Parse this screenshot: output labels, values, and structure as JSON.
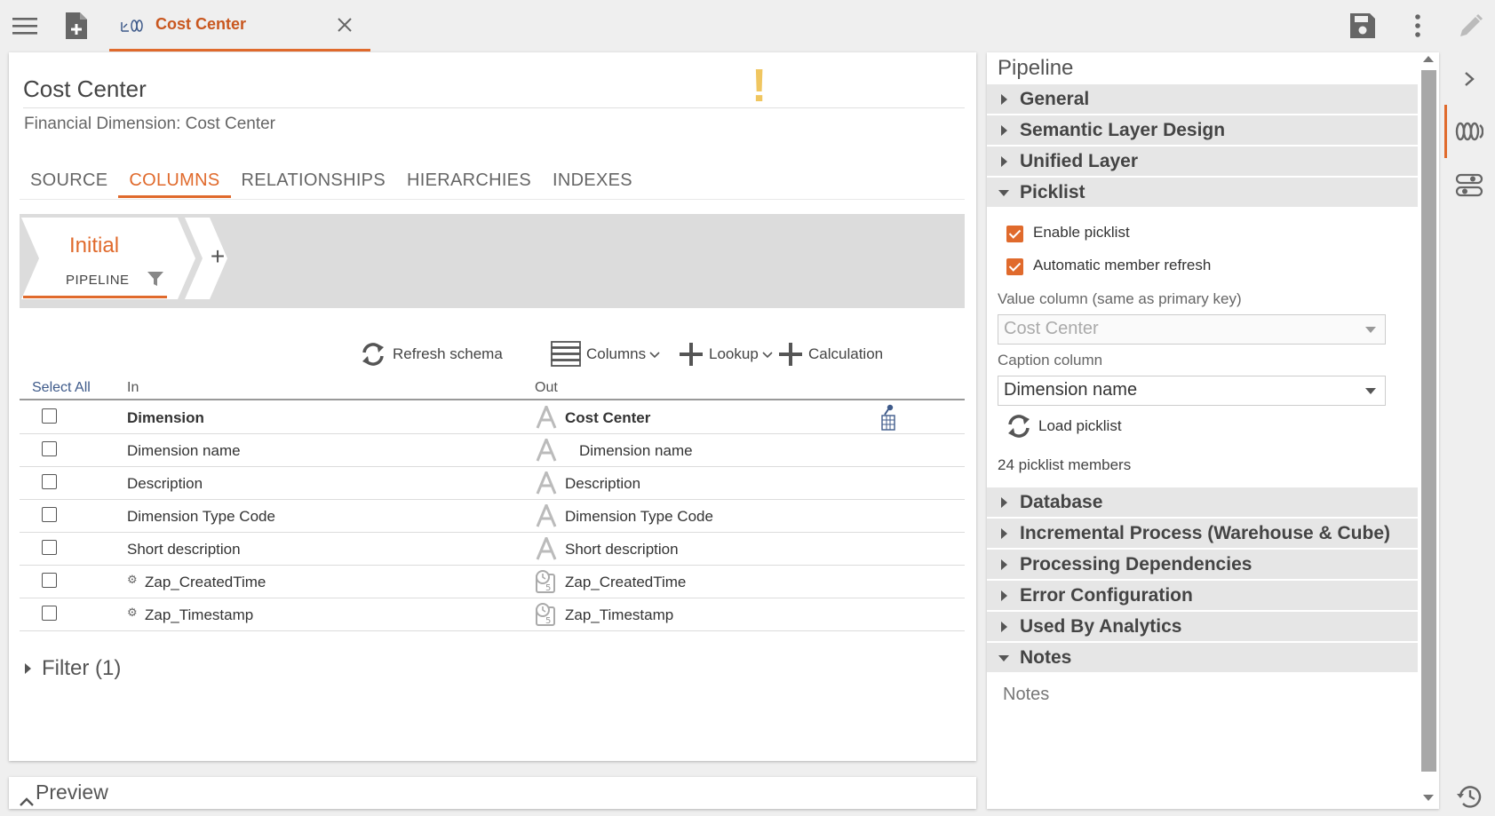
{
  "topbar": {
    "tab_title": "Cost Center",
    "icons": [
      "menu-icon",
      "new-document-icon",
      "dimension-icon",
      "close-icon",
      "save-icon",
      "more-vertical-icon",
      "edit-pencil-icon"
    ]
  },
  "main": {
    "title": "Cost Center",
    "subtitle": "Financial Dimension: Cost Center",
    "warning_glyph": "!",
    "tabs": [
      {
        "label": "SOURCE"
      },
      {
        "label": "COLUMNS"
      },
      {
        "label": "RELATIONSHIPS"
      },
      {
        "label": "HIERARCHIES"
      },
      {
        "label": "INDEXES"
      }
    ],
    "active_tab": "COLUMNS",
    "pipeline": {
      "stage_name": "Initial",
      "stage_sub": "PIPELINE",
      "add_glyph": "+"
    },
    "toolbar": {
      "refresh": "Refresh schema",
      "columns": "Columns",
      "lookup": "Lookup",
      "calculation": "Calculation"
    },
    "table": {
      "select_all": "Select All",
      "col_in": "In",
      "col_out": "Out",
      "rows": [
        {
          "in": "Dimension",
          "out": "Cost Center",
          "type": "text",
          "bold": true,
          "key": true,
          "gear": false
        },
        {
          "in": "Dimension name",
          "out": "Dimension name",
          "type": "text",
          "bold": false,
          "key": false,
          "gear": false
        },
        {
          "in": "Description",
          "out": "Description",
          "type": "text",
          "bold": false,
          "key": false,
          "gear": false
        },
        {
          "in": "Dimension Type Code",
          "out": "Dimension Type Code",
          "type": "text",
          "bold": false,
          "key": false,
          "gear": false
        },
        {
          "in": "Short description",
          "out": "Short description",
          "type": "text",
          "bold": false,
          "key": false,
          "gear": false
        },
        {
          "in": "Zap_CreatedTime",
          "out": "Zap_CreatedTime",
          "type": "datetime",
          "bold": false,
          "key": false,
          "gear": true
        },
        {
          "in": "Zap_Timestamp",
          "out": "Zap_Timestamp",
          "type": "datetime",
          "bold": false,
          "key": false,
          "gear": true
        }
      ]
    },
    "filter_label": "Filter (1)"
  },
  "preview": {
    "label": "Preview"
  },
  "side": {
    "title": "Pipeline",
    "sections": {
      "general": "General",
      "semantic": "Semantic Layer Design",
      "unified": "Unified Layer",
      "picklist": "Picklist",
      "database": "Database",
      "incremental": "Incremental Process (Warehouse & Cube)",
      "processing": "Processing Dependencies",
      "error": "Error Configuration",
      "used_by": "Used By Analytics",
      "notes": "Notes"
    },
    "picklist": {
      "enable": "Enable picklist",
      "auto_refresh": "Automatic member refresh",
      "enable_checked": true,
      "auto_refresh_checked": true,
      "value_column_label": "Value column (same as primary key)",
      "value_column": "Cost Center",
      "caption_column_label": "Caption column",
      "caption_column": "Dimension name",
      "load_button": "Load picklist",
      "members": "24 picklist members"
    },
    "notes_placeholder": "Notes"
  },
  "colors": {
    "accent": "#e06a2c",
    "warning": "#f0c660",
    "section_bg": "#e6e6e6"
  }
}
